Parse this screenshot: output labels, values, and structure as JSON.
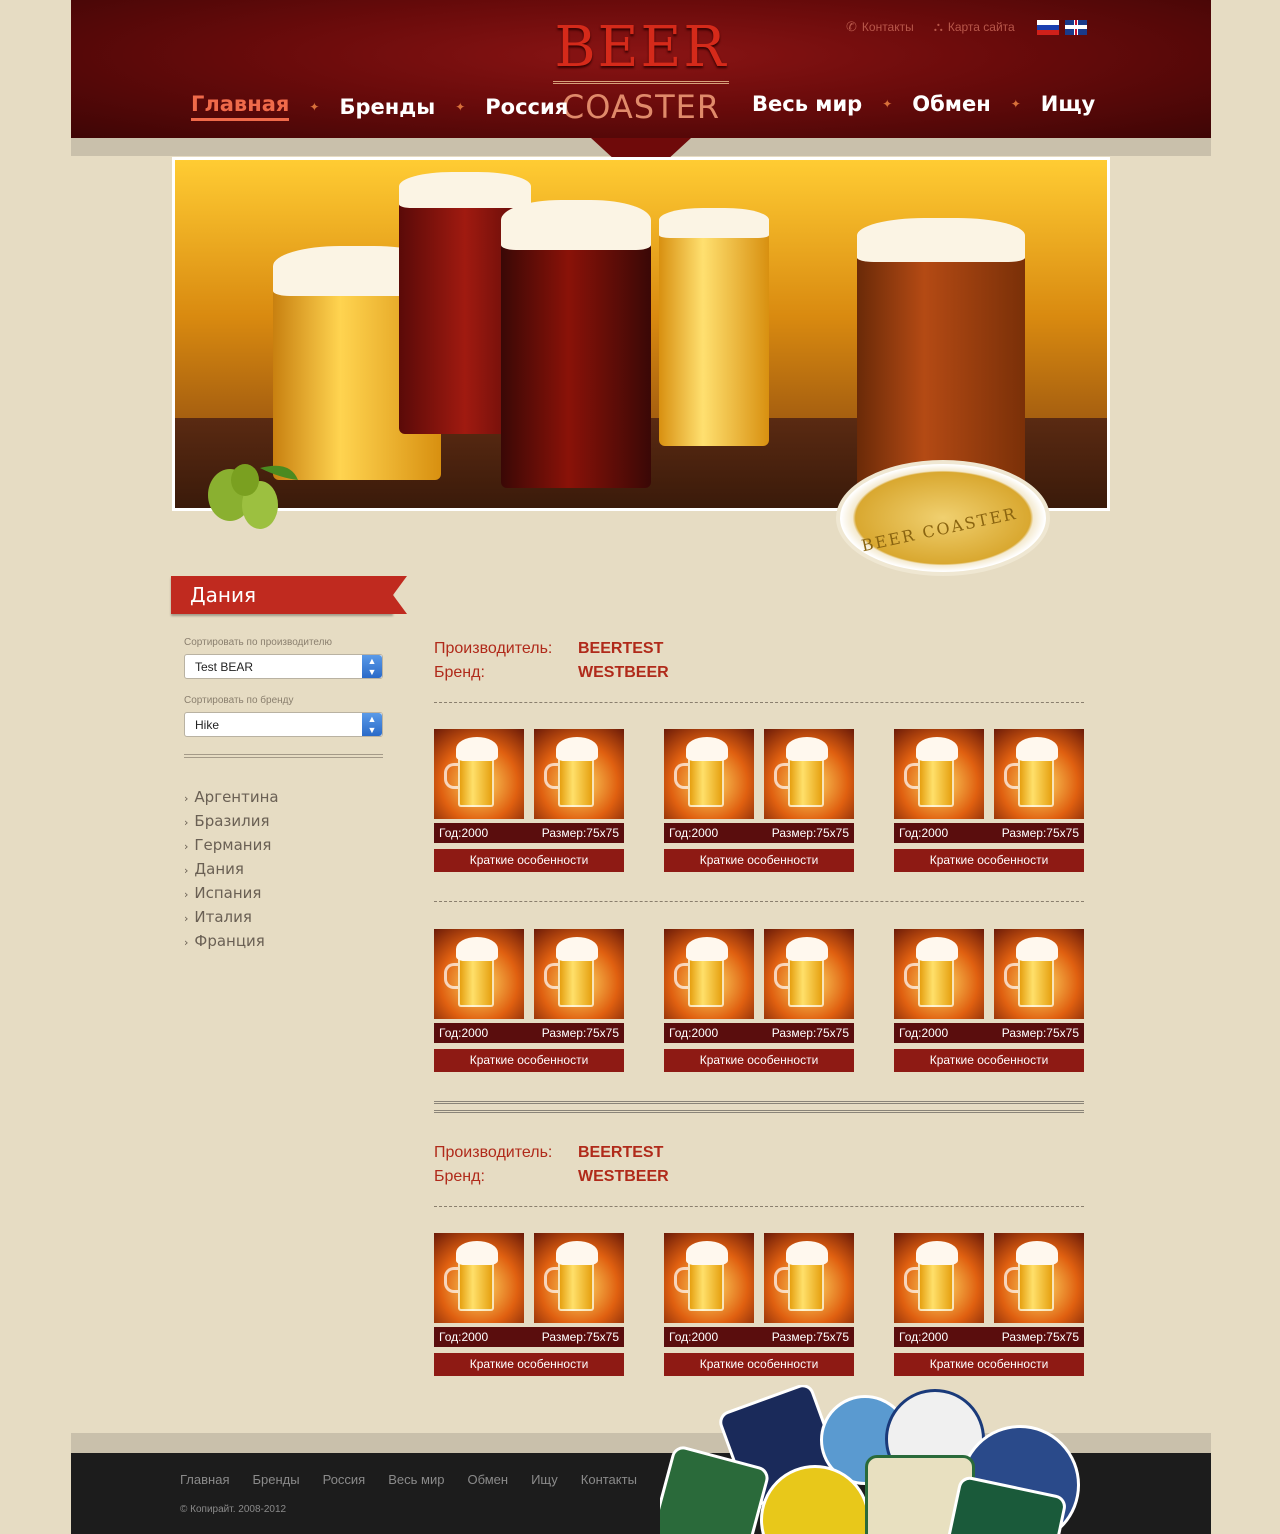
{
  "header": {
    "logo_top": "BEER",
    "logo_bottom": "COASTER",
    "contacts_label": "Контакты",
    "sitemap_label": "Карта сайта",
    "nav": [
      "Главная",
      "Бренды",
      "Россия",
      "Весь мир",
      "Обмен",
      "Ищу"
    ]
  },
  "banner": {
    "coaster_text": "BEER COASTER"
  },
  "sidebar": {
    "title": "Дания",
    "sort_manufacturer_label": "Сортировать по производителю",
    "sort_manufacturer_value": "Test BEAR",
    "sort_brand_label": "Сортировать по бренду",
    "sort_brand_value": "Hike",
    "countries": [
      "Аргентина",
      "Бразилия",
      "Германия",
      "Дания",
      "Испания",
      "Италия",
      "Франция"
    ]
  },
  "groups": [
    {
      "manufacturer_label": "Производитель:",
      "manufacturer": "BEERTEST",
      "brand_label": "Бренд:",
      "brand": "WESTBEER"
    },
    {
      "manufacturer_label": "Производитель:",
      "manufacturer": "BEERTEST",
      "brand_label": "Бренд:",
      "brand": "WESTBEER"
    }
  ],
  "card": {
    "year": "Год:2000",
    "size": "Размер:75x75",
    "features": "Краткие особенности"
  },
  "footer": {
    "nav": [
      "Главная",
      "Бренды",
      "Россия",
      "Весь мир",
      "Обмен",
      "Ищу",
      "Контакты"
    ],
    "copyright": "© Копирайт. 2008-2012"
  },
  "colors": {
    "background": "#e6dcc3",
    "header": "#6a0b0b",
    "accent": "#c02a1f",
    "footer": "#1c1c1c"
  }
}
